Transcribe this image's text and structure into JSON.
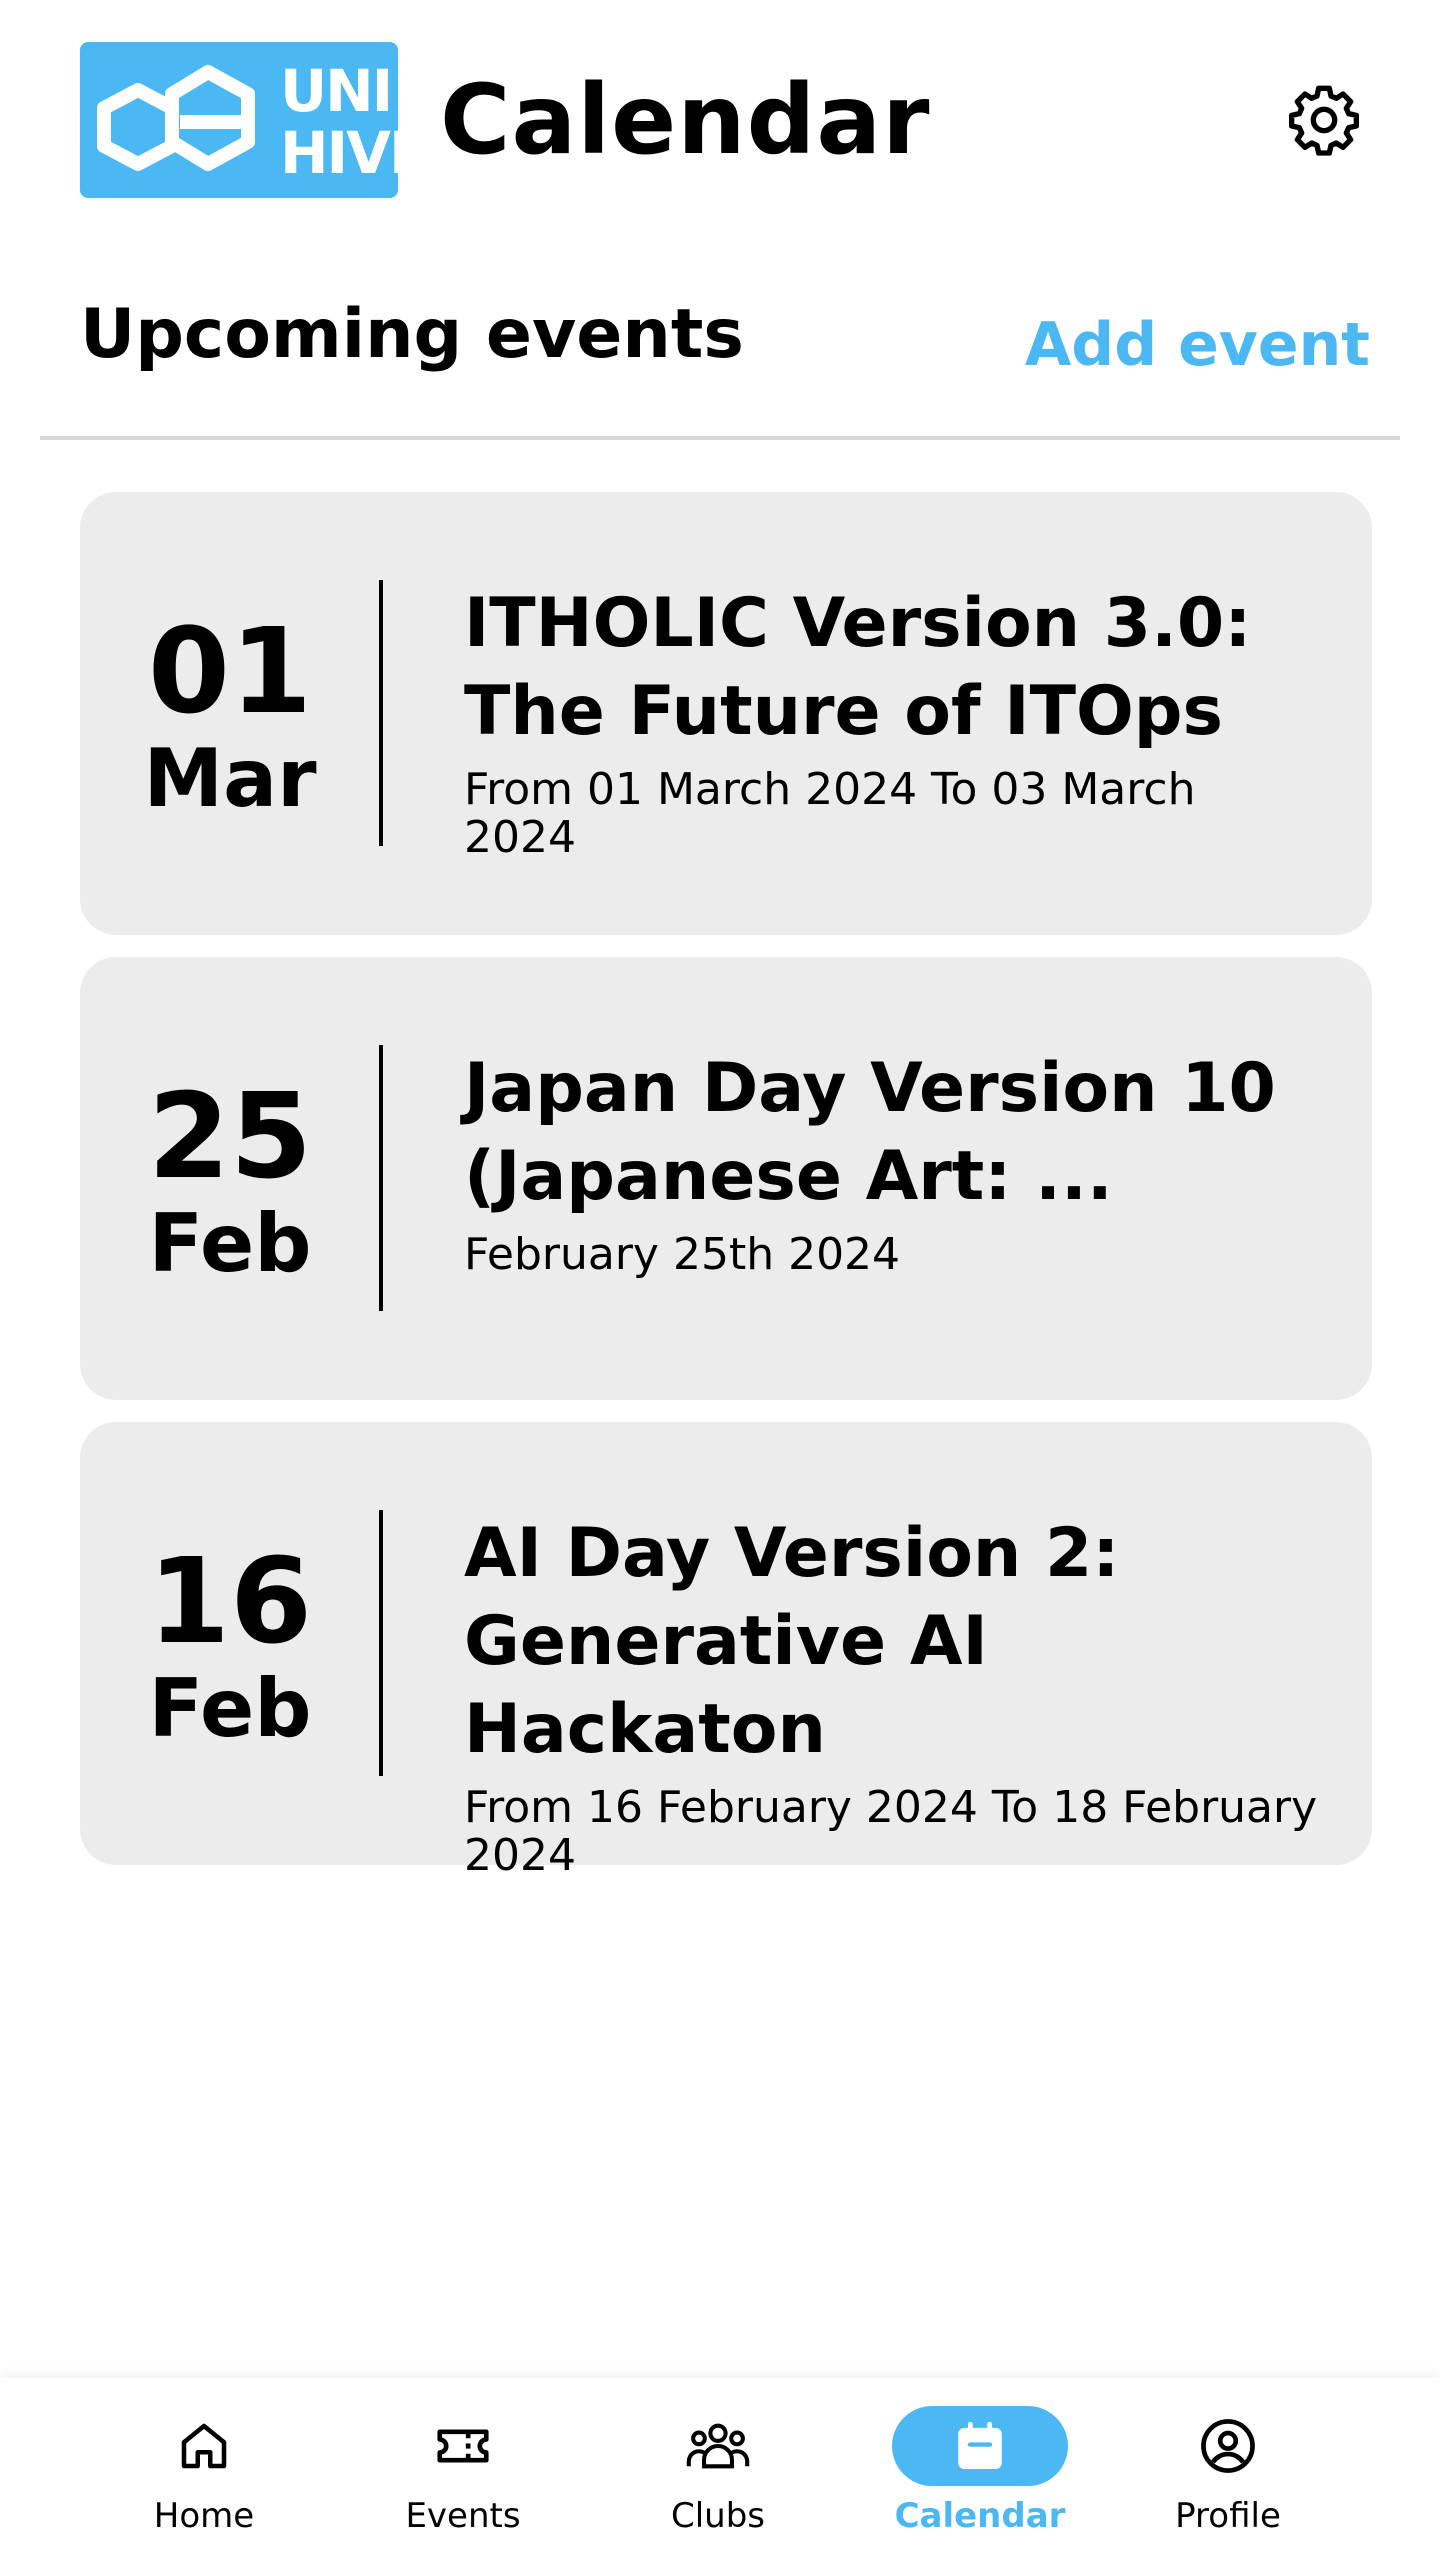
{
  "header": {
    "logo_line1": "UNI",
    "logo_line2": "HIVE",
    "title": "Calendar",
    "settings_icon": "gear-icon"
  },
  "section": {
    "title": "Upcoming events",
    "add_event_label": "Add event"
  },
  "events": [
    {
      "day": "01",
      "month": "Mar",
      "title": "ITHOLIC Version 3.0:\nThe Future of ITOps",
      "dates": "From 01 March 2024 To 03 March\n2024"
    },
    {
      "day": "25",
      "month": "Feb",
      "title": "Japan Day Version 10\n(Japanese Art: ...",
      "dates": "February 25th 2024"
    },
    {
      "day": "16",
      "month": "Feb",
      "title": "AI Day Version 2:\nGenerative AI Hackaton",
      "dates": "From 16 February 2024 To 18 February\n2024"
    }
  ],
  "nav": {
    "items": [
      {
        "label": "Home",
        "icon": "home-icon"
      },
      {
        "label": "Events",
        "icon": "ticket-icon"
      },
      {
        "label": "Clubs",
        "icon": "group-icon"
      },
      {
        "label": "Calendar",
        "icon": "calendar-icon",
        "active": true
      },
      {
        "label": "Profile",
        "icon": "profile-icon"
      }
    ]
  },
  "colors": {
    "accent": "#4bb8f3",
    "card_bg": "#ececec",
    "divider": "#d8d8d8"
  }
}
